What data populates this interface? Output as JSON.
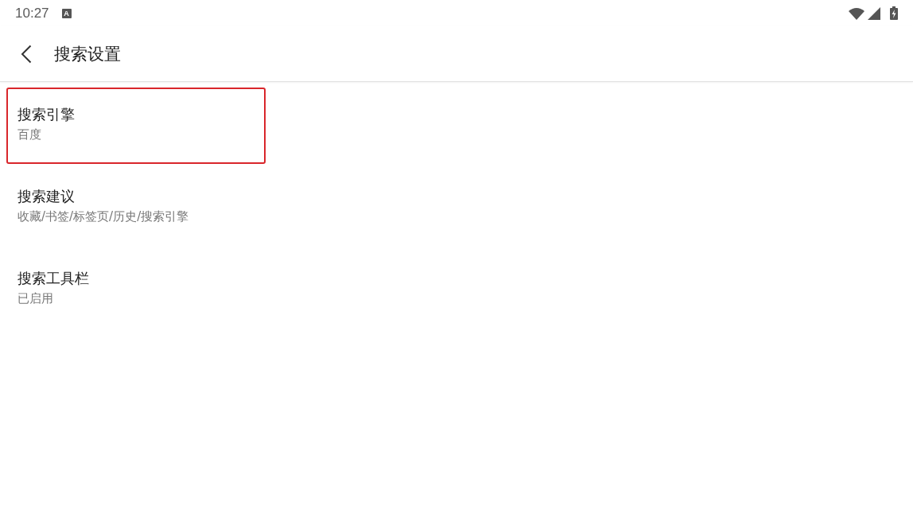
{
  "status_bar": {
    "time": "10:27",
    "notification_icon": "A"
  },
  "app_bar": {
    "title": "搜索设置"
  },
  "items": [
    {
      "title": "搜索引擎",
      "summary": "百度",
      "highlighted": true
    },
    {
      "title": "搜索建议",
      "summary": "收藏/书签/标签页/历史/搜索引擎",
      "highlighted": false
    },
    {
      "title": "搜索工具栏",
      "summary": "已启用",
      "highlighted": false
    }
  ]
}
